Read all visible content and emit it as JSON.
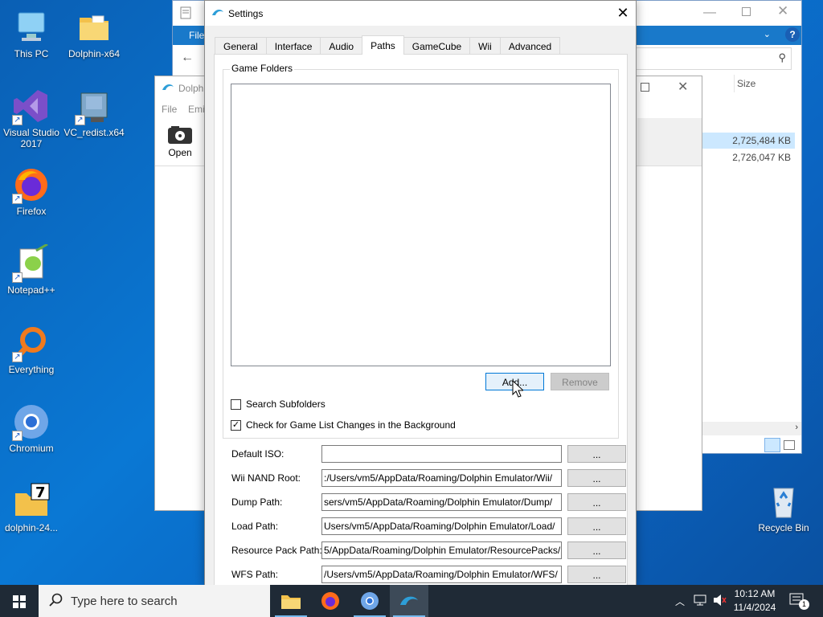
{
  "desktop": {
    "icons": [
      {
        "label": "This PC"
      },
      {
        "label": "Dolphin-x64"
      },
      {
        "label": "Visual Studio 2017"
      },
      {
        "label": "VC_redist.x64"
      },
      {
        "label": "Firefox"
      },
      {
        "label": "Notepad++"
      },
      {
        "label": "Everything"
      },
      {
        "label": "Chromium"
      },
      {
        "label": "dolphin-24..."
      },
      {
        "label": "Recycle Bin"
      }
    ]
  },
  "explorer": {
    "ribbon_file": "File",
    "column_size": "Size",
    "rows": [
      "2,725,484 KB",
      "2,726,047 KB"
    ]
  },
  "dolphin_main": {
    "title": "Dolph",
    "menu_file": "File",
    "menu_emu": "Emi",
    "open_label": "Open"
  },
  "settings": {
    "title": "Settings",
    "tabs": [
      "General",
      "Interface",
      "Audio",
      "Paths",
      "GameCube",
      "Wii",
      "Advanced"
    ],
    "active_tab": "Paths",
    "game_folders_label": "Game Folders",
    "add_button": "Add...",
    "remove_button": "Remove",
    "search_subfolders": {
      "label": "Search Subfolders",
      "checked": false
    },
    "check_changes": {
      "label": "Check for Game List Changes in the Background",
      "checked": true
    },
    "paths": [
      {
        "label": "Default ISO:",
        "value": "",
        "button": "..."
      },
      {
        "label": "Wii NAND Root:",
        "value": ":/Users/vm5/AppData/Roaming/Dolphin Emulator/Wii/",
        "button": "..."
      },
      {
        "label": "Dump Path:",
        "value": "sers/vm5/AppData/Roaming/Dolphin Emulator/Dump/",
        "button": "..."
      },
      {
        "label": "Load Path:",
        "value": "Users/vm5/AppData/Roaming/Dolphin Emulator/Load/",
        "button": "..."
      },
      {
        "label": "Resource Pack Path:",
        "value": "5/AppData/Roaming/Dolphin Emulator/ResourcePacks/",
        "button": "..."
      },
      {
        "label": "WFS Path:",
        "value": "/Users/vm5/AppData/Roaming/Dolphin Emulator/WFS/",
        "button": "..."
      }
    ]
  },
  "taskbar": {
    "search_placeholder": "Type here to search",
    "time": "10:12 AM",
    "date": "11/4/2024",
    "notification_count": "1"
  },
  "colors": {
    "desktop": "#0a6cc4",
    "taskbar": "#1f2a36",
    "accent": "#0078d7"
  }
}
